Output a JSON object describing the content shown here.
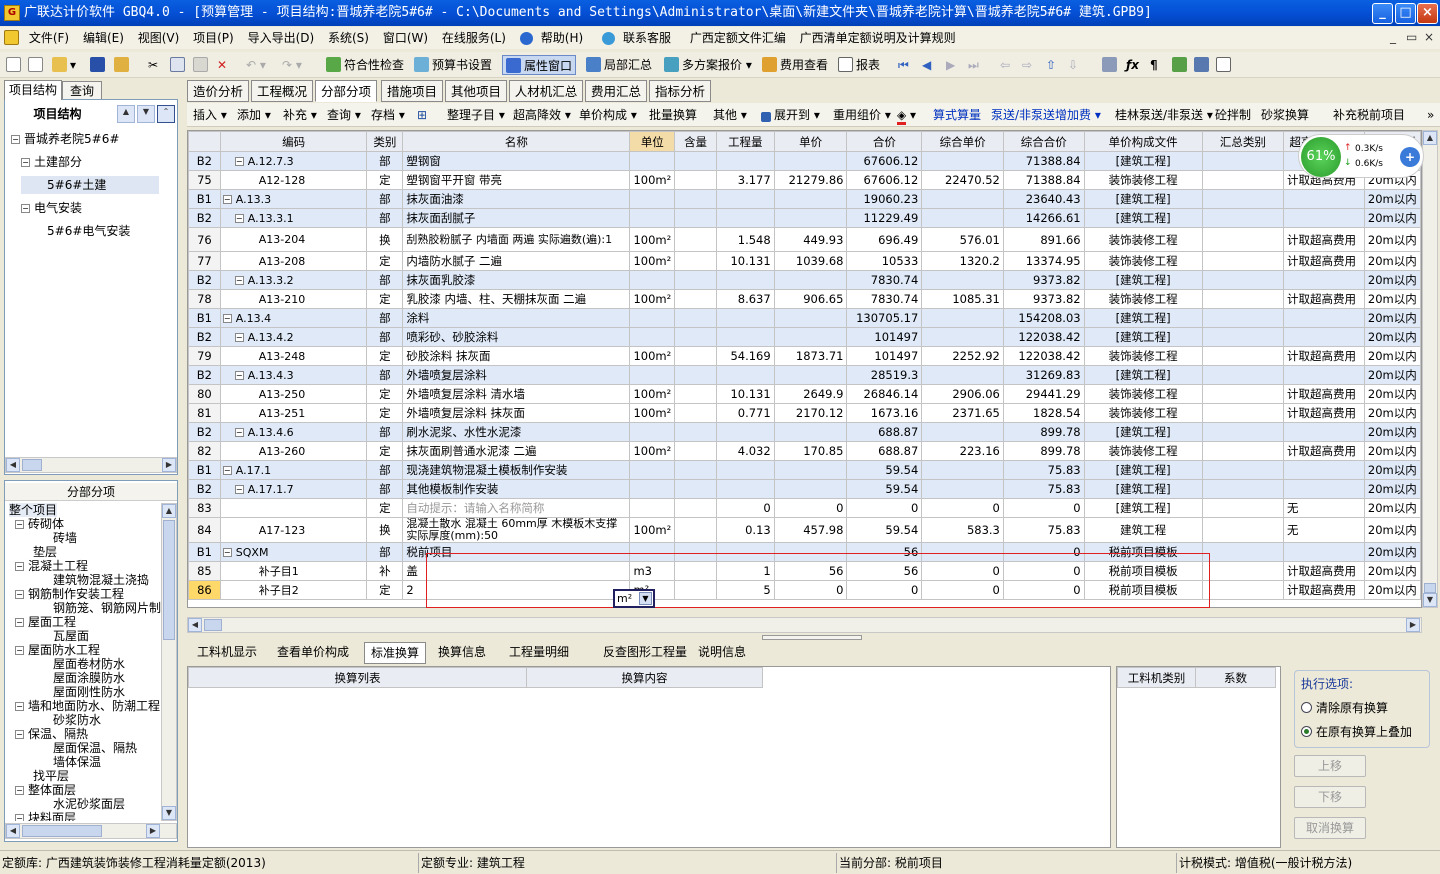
{
  "window": {
    "title": "广联达计价软件 GBQ4.0 - [预算管理 - 项目结构:晋城养老院5#6# - C:\\Documents and Settings\\Administrator\\桌面\\新建文件夹\\晋城养老院计算\\晋城养老院5#6# 建筑.GPB9]",
    "min": "_",
    "max": "□",
    "close": "×"
  },
  "menu": [
    "文件(F)",
    "编辑(E)",
    "视图(V)",
    "项目(P)",
    "导入导出(D)",
    "系统(S)",
    "窗口(W)",
    "在线服务(L)",
    "帮助(H)",
    "联系客服",
    "广西定额文件汇编",
    "广西清单定额说明及计算规则"
  ],
  "toolbar": {
    "check": "符合性检查",
    "preset": "预算书设置",
    "props": "属性窗口",
    "local": "局部汇总",
    "multi": "多方案报价",
    "fee": "费用查看",
    "report": "报表"
  },
  "left": {
    "tab1": "项目结构",
    "tab2": "查询",
    "tree_title": "项目结构",
    "tree": [
      {
        "label": "晋城养老院5#6#"
      },
      {
        "label": "土建部分"
      },
      {
        "label": "5#6#土建"
      },
      {
        "label": "电气安装"
      },
      {
        "label": "5#6#电气安装"
      }
    ],
    "section_title": "分部分项",
    "sections": [
      "整个项目",
      "砖砌体",
      "砖墙",
      "垫层",
      "混凝土工程",
      "建筑物混凝土浇捣",
      "钢筋制作安装工程",
      "钢筋笼、钢筋网片制",
      "屋面工程",
      "瓦屋面",
      "屋面防水工程",
      "屋面卷材防水",
      "屋面涂膜防水",
      "屋面刚性防水",
      "墙和地面防水、防潮工程",
      "砂浆防水",
      "保温、隔热",
      "屋面保温、隔热",
      "墙体保温",
      "找平层",
      "整体面层",
      "水泥砂浆面层",
      "块料面层"
    ]
  },
  "tabs": [
    "造价分析",
    "工程概况",
    "分部分项",
    "措施项目",
    "其他项目",
    "人材机汇总",
    "费用汇总",
    "指标分析"
  ],
  "toolbar2": {
    "insert": "插入",
    "add": "添加",
    "supp": "补充",
    "query": "查询",
    "save": "存档",
    "arrange": "整理子目",
    "over": "超高降效",
    "unitcomp": "单价构成",
    "batch": "批量换算",
    "other": "其他",
    "expand": "展开到",
    "reuse": "重用组价",
    "formula": "算式算量",
    "pump": "泵送/非泵送增加费",
    "guilin": "桂林泵送/非泵送",
    "masonry": "砼拌制",
    "mortar": "砂浆换算",
    "prev": "补充税前项目"
  },
  "columns": [
    "编码",
    "类别",
    "名称",
    "单位",
    "含量",
    "工程量",
    "单价",
    "合价",
    "综合单价",
    "综合合价",
    "单价构成文件",
    "汇总类别",
    "超高过滤类别",
    "檐高类别"
  ],
  "rows": [
    [
      "B2",
      "A.12.7.3",
      "部",
      "塑钢窗",
      "",
      "",
      "",
      "",
      "67606.12",
      "",
      "71388.84",
      "[建筑工程]",
      "",
      "",
      "20m以内"
    ],
    [
      "75",
      "A12-128",
      "定",
      "塑钢窗平开窗 带亮",
      "100m²",
      "",
      "3.177",
      "21279.86",
      "67606.12",
      "22470.52",
      "71388.84",
      "装饰装修工程",
      "",
      "计取超高费用",
      "20m以内"
    ],
    [
      "B1",
      "A.13.3",
      "部",
      "抹灰面油漆",
      "",
      "",
      "",
      "",
      "19060.23",
      "",
      "23640.43",
      "[建筑工程]",
      "",
      "",
      "20m以内"
    ],
    [
      "B2",
      "A.13.3.1",
      "部",
      "抹灰面刮腻子",
      "",
      "",
      "",
      "",
      "11229.49",
      "",
      "14266.61",
      "[建筑工程]",
      "",
      "",
      "20m以内"
    ],
    [
      "76",
      "A13-204",
      "换",
      "刮熟胶粉腻子 内墙面 两遍 实际遍数(遍):1",
      "100m²",
      "",
      "1.548",
      "449.93",
      "696.49",
      "576.01",
      "891.66",
      "装饰装修工程",
      "",
      "计取超高费用",
      "20m以内"
    ],
    [
      "77",
      "A13-208",
      "定",
      "内墙防水腻子 二遍",
      "100m²",
      "",
      "10.131",
      "1039.68",
      "10533",
      "1320.2",
      "13374.95",
      "装饰装修工程",
      "",
      "计取超高费用",
      "20m以内"
    ],
    [
      "B2",
      "A.13.3.2",
      "部",
      "抹灰面乳胶漆",
      "",
      "",
      "",
      "",
      "7830.74",
      "",
      "9373.82",
      "[建筑工程]",
      "",
      "",
      "20m以内"
    ],
    [
      "78",
      "A13-210",
      "定",
      "乳胶漆 内墙、柱、天棚抹灰面 二遍",
      "100m²",
      "",
      "8.637",
      "906.65",
      "7830.74",
      "1085.31",
      "9373.82",
      "装饰装修工程",
      "",
      "计取超高费用",
      "20m以内"
    ],
    [
      "B1",
      "A.13.4",
      "部",
      "涂料",
      "",
      "",
      "",
      "",
      "130705.17",
      "",
      "154208.03",
      "[建筑工程]",
      "",
      "",
      "20m以内"
    ],
    [
      "B2",
      "A.13.4.2",
      "部",
      "喷彩砂、砂胶涂料",
      "",
      "",
      "",
      "",
      "101497",
      "",
      "122038.42",
      "[建筑工程]",
      "",
      "",
      "20m以内"
    ],
    [
      "79",
      "A13-248",
      "定",
      "砂胶涂料 抹灰面",
      "100m²",
      "",
      "54.169",
      "1873.71",
      "101497",
      "2252.92",
      "122038.42",
      "装饰装修工程",
      "",
      "计取超高费用",
      "20m以内"
    ],
    [
      "B2",
      "A.13.4.3",
      "部",
      "外墙喷复层涂料",
      "",
      "",
      "",
      "",
      "28519.3",
      "",
      "31269.83",
      "[建筑工程]",
      "",
      "",
      "20m以内"
    ],
    [
      "80",
      "A13-250",
      "定",
      "外墙喷复层涂料 清水墙",
      "100m²",
      "",
      "10.131",
      "2649.9",
      "26846.14",
      "2906.06",
      "29441.29",
      "装饰装修工程",
      "",
      "计取超高费用",
      "20m以内"
    ],
    [
      "81",
      "A13-251",
      "定",
      "外墙喷复层涂料 抹灰面",
      "100m²",
      "",
      "0.771",
      "2170.12",
      "1673.16",
      "2371.65",
      "1828.54",
      "装饰装修工程",
      "",
      "计取超高费用",
      "20m以内"
    ],
    [
      "B2",
      "A.13.4.6",
      "部",
      "刷水泥浆、水性水泥漆",
      "",
      "",
      "",
      "",
      "688.87",
      "",
      "899.78",
      "[建筑工程]",
      "",
      "",
      "20m以内"
    ],
    [
      "82",
      "A13-260",
      "定",
      "抹灰面刷普通水泥漆 二遍",
      "100m²",
      "",
      "4.032",
      "170.85",
      "688.87",
      "223.16",
      "899.78",
      "装饰装修工程",
      "",
      "计取超高费用",
      "20m以内"
    ],
    [
      "B1",
      "A.17.1",
      "部",
      "现浇建筑物混凝土模板制作安装",
      "",
      "",
      "",
      "",
      "59.54",
      "",
      "75.83",
      "[建筑工程]",
      "",
      "",
      "20m以内"
    ],
    [
      "B2",
      "A.17.1.7",
      "部",
      "其他模板制作安装",
      "",
      "",
      "",
      "",
      "59.54",
      "",
      "75.83",
      "[建筑工程]",
      "",
      "",
      "20m以内"
    ],
    [
      "83",
      "",
      "定",
      "自动提示：请输入名称简称",
      "",
      "",
      "0",
      "0",
      "0",
      "0",
      "0",
      "[建筑工程]",
      "",
      "无",
      "20m以内"
    ],
    [
      "84",
      "A17-123",
      "换",
      "混凝土散水 混凝土 60mm厚 木模板木支撑 实际厚度(mm):50",
      "100m²",
      "",
      "0.13",
      "457.98",
      "59.54",
      "583.3",
      "75.83",
      "建筑工程",
      "",
      "无",
      "20m以内"
    ],
    [
      "B1",
      "SQXM",
      "部",
      "税前项目",
      "",
      "",
      "",
      "",
      "56",
      "",
      "0",
      "税前项目模板",
      "",
      "",
      "20m以内"
    ],
    [
      "85",
      "补子目1",
      "补",
      "盖",
      "m3",
      "",
      "1",
      "56",
      "56",
      "0",
      "0",
      "税前项目模板",
      "",
      "计取超高费用",
      "20m以内"
    ],
    [
      "86",
      "补子目2",
      "定",
      "2",
      "m²",
      "",
      "5",
      "0",
      "0",
      "0",
      "0",
      "税前项目模板",
      "",
      "计取超高费用",
      "20m以内"
    ]
  ],
  "speed": {
    "pct": "61%",
    "up": "0.3K/s",
    "down": "0.6K/s"
  },
  "bottom_tabs": [
    "工料机显示",
    "查看单价构成",
    "标准换算",
    "换算信息",
    "工程量明细",
    "反查图形工程量",
    "说明信息"
  ],
  "bottom_cols": [
    "换算列表",
    "换算内容"
  ],
  "right_cols": [
    "工料机类别",
    "系数"
  ],
  "exec": {
    "title": "执行选项:",
    "opt1": "清除原有换算",
    "opt2": "在原有换算上叠加"
  },
  "buttons": {
    "up": "上移",
    "down": "下移",
    "cancel": "取消换算"
  },
  "status": {
    "lib": "定额库: 广西建筑装饰装修工程消耗量定额(2013)",
    "major": "定额专业: 建筑工程",
    "current": "当前分部: 税前项目",
    "tax": "计税模式: 增值税(一般计税方法)"
  }
}
